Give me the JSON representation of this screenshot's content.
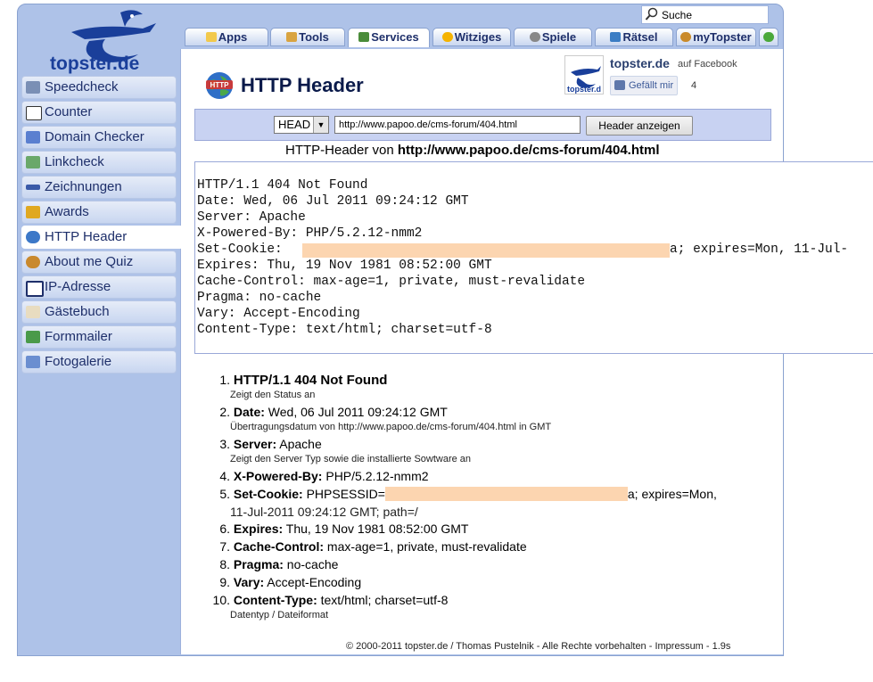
{
  "logo": {
    "text": "topster.de"
  },
  "search": {
    "label": "Suche"
  },
  "tabs": [
    {
      "label": "Apps",
      "icon": "folder-icon"
    },
    {
      "label": "Tools",
      "icon": "tools-icon"
    },
    {
      "label": "Services",
      "icon": "services-icon"
    },
    {
      "label": "Witziges",
      "icon": "smiley-icon"
    },
    {
      "label": "Spiele",
      "icon": "gamepad-icon"
    },
    {
      "label": "Rätsel",
      "icon": "puzzle-icon"
    },
    {
      "label": "myTopster",
      "icon": "user-icon"
    }
  ],
  "sidebar": {
    "items": [
      {
        "label": "Speedcheck",
        "icon": "speed-icon"
      },
      {
        "label": "Counter",
        "icon": "counter-icon"
      },
      {
        "label": "Domain Checker",
        "icon": "domain-icon"
      },
      {
        "label": "Linkcheck",
        "icon": "link-icon"
      },
      {
        "label": "Zeichnungen",
        "icon": "pencil-icon"
      },
      {
        "label": "Awards",
        "icon": "trophy-icon"
      },
      {
        "label": "HTTP Header",
        "icon": "globe-icon"
      },
      {
        "label": "About me Quiz",
        "icon": "quiz-icon"
      },
      {
        "label": "IP-Adresse",
        "icon": "ip-icon"
      },
      {
        "label": "Gästebuch",
        "icon": "guestbook-icon"
      },
      {
        "label": "Formmailer",
        "icon": "mail-icon"
      },
      {
        "label": "Fotogalerie",
        "icon": "photo-icon"
      }
    ]
  },
  "page": {
    "title": "HTTP Header"
  },
  "facebook": {
    "name": "topster.de",
    "on": "auf Facebook",
    "like_label": "Gefällt mir",
    "count": "4"
  },
  "form": {
    "method": "HEAD",
    "url": "http://www.papoo.de/cms-forum/404.html",
    "submit_label": "Header anzeigen"
  },
  "result": {
    "prefix": "HTTP-Header von ",
    "url": "http://www.papoo.de/cms-forum/404.html"
  },
  "raw_headers": [
    "HTTP/1.1 404 Not Found",
    "Date: Wed, 06 Jul 2011 09:24:12 GMT",
    "Server: Apache",
    "X-Powered-By: PHP/5.2.12-nmm2",
    "Set-Cookie:",
    "Expires: Thu, 19 Nov 1981 08:52:00 GMT",
    "Cache-Control: max-age=1, private, must-revalidate",
    "Pragma: no-cache",
    "Vary: Accept-Encoding",
    "Content-Type: text/html; charset=utf-8"
  ],
  "raw_cookie_tail": "a; expires=Mon, 11-Jul-",
  "header_list": [
    {
      "num": "1.",
      "name": "HTTP/1.1 404 Not Found",
      "value": "",
      "desc": "Zeigt den Status an"
    },
    {
      "num": "2.",
      "name": "Date:",
      "value": " Wed, 06 Jul 2011 09:24:12 GMT",
      "desc": "Übertragungsdatum von http://www.papoo.de/cms-forum/404.html in GMT"
    },
    {
      "num": "3.",
      "name": "Server:",
      "value": " Apache",
      "desc": "Zeigt den Server Typ sowie die installierte Sowtware an"
    },
    {
      "num": "4.",
      "name": "X-Powered-By:",
      "value": " PHP/5.2.12-nmm2",
      "desc": ""
    },
    {
      "num": "5.",
      "name": "Set-Cookie:",
      "value": " PHPSESSID=",
      "desc": ""
    },
    {
      "num": "6.",
      "name": "Expires:",
      "value": " Thu, 19 Nov 1981 08:52:00 GMT",
      "desc": ""
    },
    {
      "num": "7.",
      "name": "Cache-Control:",
      "value": " max-age=1, private, must-revalidate",
      "desc": ""
    },
    {
      "num": "8.",
      "name": "Pragma:",
      "value": " no-cache",
      "desc": ""
    },
    {
      "num": "9.",
      "name": "Vary:",
      "value": " Accept-Encoding",
      "desc": ""
    },
    {
      "num": "10.",
      "name": "Content-Type:",
      "value": " text/html; charset=utf-8",
      "desc": "Datentyp / Dateiformat"
    }
  ],
  "cookie_tail": "a; expires=Mon,",
  "cookie_line2": "11-Jul-2011 09:24:12 GMT; path=/",
  "footer": "© 2000-2011 topster.de / Thomas Pustelnik - Alle Rechte vorbehalten - Impressum - 1.9s",
  "colors": {
    "frame": "#aec2e8",
    "accent": "#1a3f9a",
    "redaction": "#fcd5b0"
  }
}
